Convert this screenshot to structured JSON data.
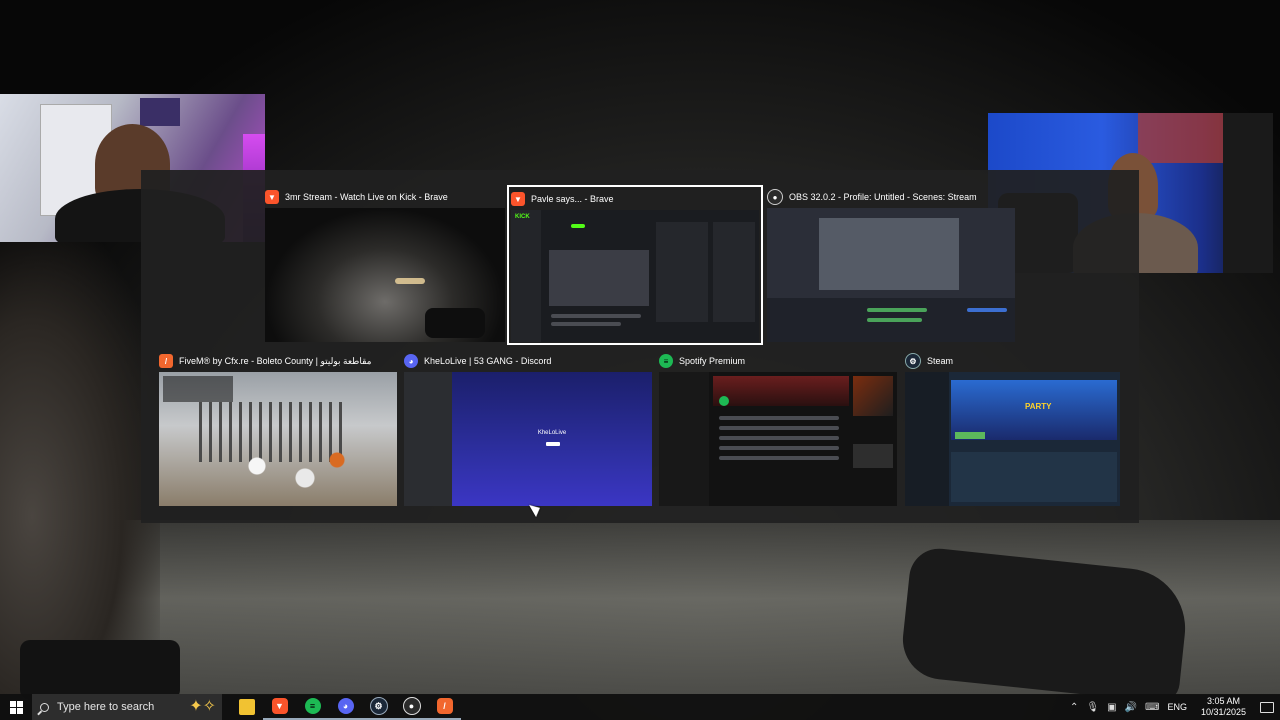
{
  "switcher": {
    "windows": [
      {
        "title": "3mr Stream - Watch Live on Kick - Brave",
        "icon": "brave-icon",
        "color": "#fb542b"
      },
      {
        "title": "Pavle says... - Brave",
        "icon": "brave-icon",
        "color": "#fb542b",
        "selected": true
      },
      {
        "title": "OBS 32.0.2 - Profile: Untitled - Scenes: Stream",
        "icon": "obs-icon",
        "color": "#2b2b2b"
      },
      {
        "title": "FiveM® by Cfx.re - Boleto County | مقاطعة بوليتو",
        "icon": "fivem-icon",
        "color": "#f2672e"
      },
      {
        "title": "KheLoLive | 53 GANG - Discord",
        "icon": "discord-icon",
        "color": "#5865f2"
      },
      {
        "title": "Spotify Premium",
        "icon": "spotify-icon",
        "color": "#1db954"
      },
      {
        "title": "Steam",
        "icon": "steam-icon",
        "color": "#1b2838"
      }
    ],
    "thumb_text": {
      "kick_logo": "KICK",
      "discord_server": "KheLoLive",
      "steam_banner": "PARTY"
    }
  },
  "taskbar": {
    "search_placeholder": "Type here to search",
    "pinned": [
      "file-explorer-icon",
      "brave-icon",
      "spotify-icon",
      "discord-icon",
      "steam-icon",
      "obs-icon",
      "fivem-icon"
    ],
    "language": "ENG",
    "time": "3:05 AM",
    "date": "10/31/2025"
  }
}
